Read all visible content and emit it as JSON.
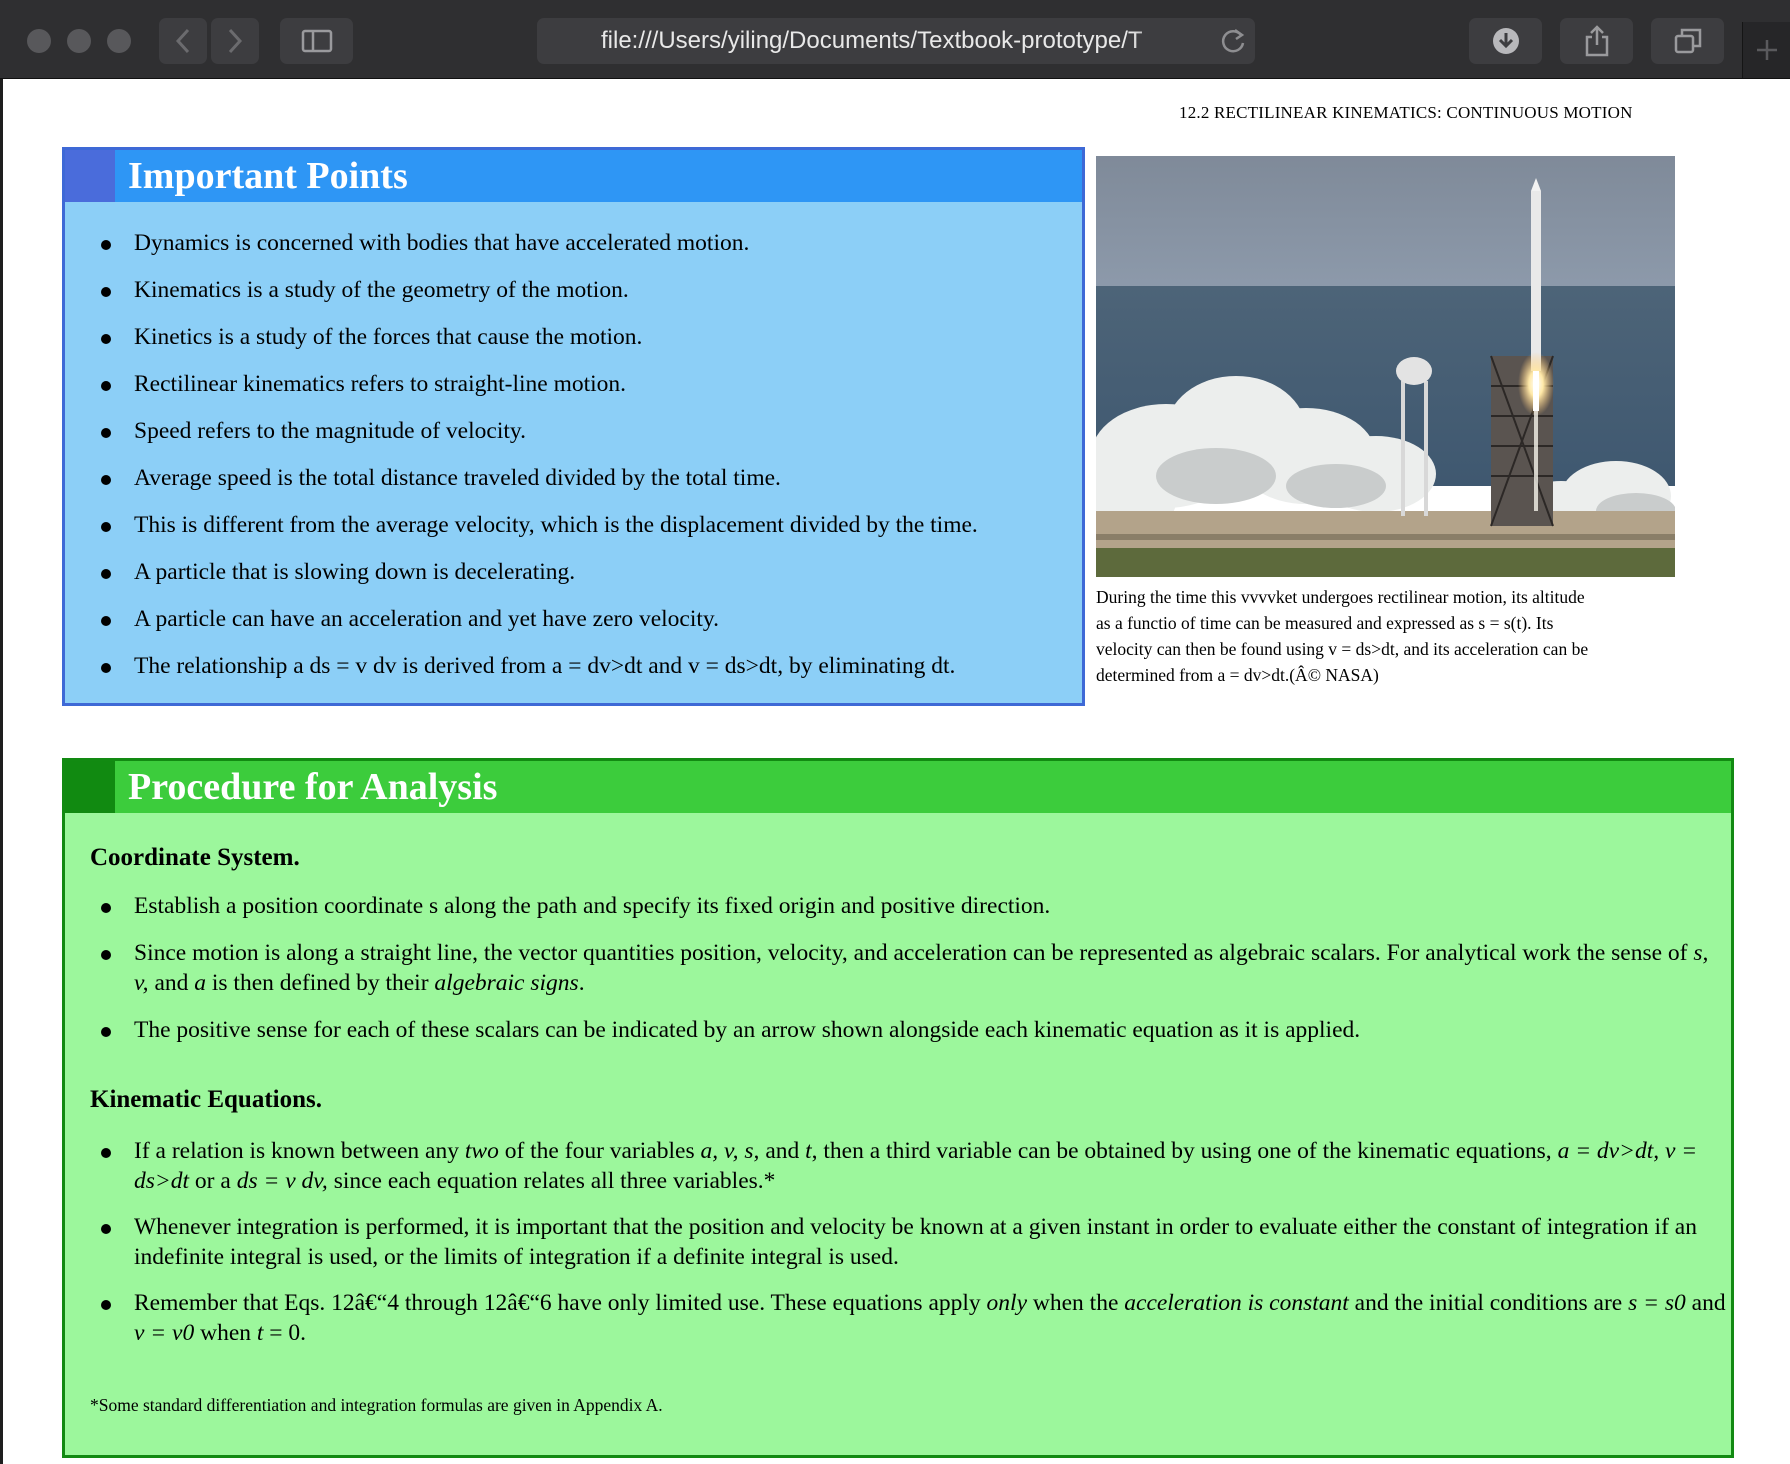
{
  "browser": {
    "address": "file:///Users/yiling/Documents/Textbook-prototype/T"
  },
  "page": {
    "running_head": "12.2 RECTILINEAR KINEMATICS: CONTINUOUS MOTION",
    "important_points": {
      "title": "Important Points",
      "items": [
        "Dynamics is concerned with bodies that have accelerated motion.",
        "Kinematics is a study of the geometry of the motion.",
        "Kinetics is a study of the forces that cause the motion.",
        "Rectilinear kinematics refers to straight-line motion.",
        "Speed refers to the magnitude of velocity.",
        "Average speed is the total distance traveled divided by the total time.",
        "This is different from the average velocity, which is the displacement divided by the time.",
        "A particle that is slowing down is decelerating.",
        "A particle can have an acceleration and yet have zero velocity.",
        "The relationship a ds = v dv is derived from a = dv>dt and v = ds>dt, by eliminating dt."
      ]
    },
    "figure": {
      "caption_lines": [
        "During the time this vvvvket undergoes rectilinear motion, its altitude",
        "as a functio of time can be measured and expressed as s = s(t). Its",
        "velocity can then be found using v = ds>dt, and its acceleration can be",
        "determined from a = dv>dt.(Â© NASA)"
      ]
    },
    "procedure": {
      "title": "Procedure for Analysis",
      "coordinate_title": "Coordinate System.",
      "coordinate_items": [
        "Establish a position coordinate s along the path and specify its fixed origin and positive direction.",
        "Since motion is along a straight line, the vector quantities position, velocity, and acceleration can be represented as algebraic scalars. For analytical work the sense of <i>s, v,</i> and <i>a</i> is then defined by their <i>algebraic signs</i>.",
        "The positive sense for each of these scalars can be indicated by an arrow shown alongside each kinematic equation as it is applied."
      ],
      "kinematic_title": "Kinematic Equations.",
      "kinematic_items": [
        "If a relation is known between any <i>two</i> of the four variables <i>a, v, s,</i> and <i>t</i>, then a third variable can be obtained by using one of the kinematic equations, <i>a = dv>dt, v = ds>dt</i> or a <i>ds = v dv,</i> since each equation relates all three variables.*",
        "Whenever integration is performed, it is important that the position and velocity be known at a given instant in order to evaluate either the constant of integration if an indefinite integral is used, or the limits of integration if a definite integral is used.",
        "Remember that Eqs. 12â€“4 through 12â€“6 have only limited use. These equations apply <i>only</i> when the <i>acceleration is constant</i> and the initial conditions are <i>s = s0</i> and <i>v = v0</i> when <i>t</i> = 0."
      ],
      "footnote": "*Some standard differentiation and integration formulas are given in Appendix A."
    }
  }
}
